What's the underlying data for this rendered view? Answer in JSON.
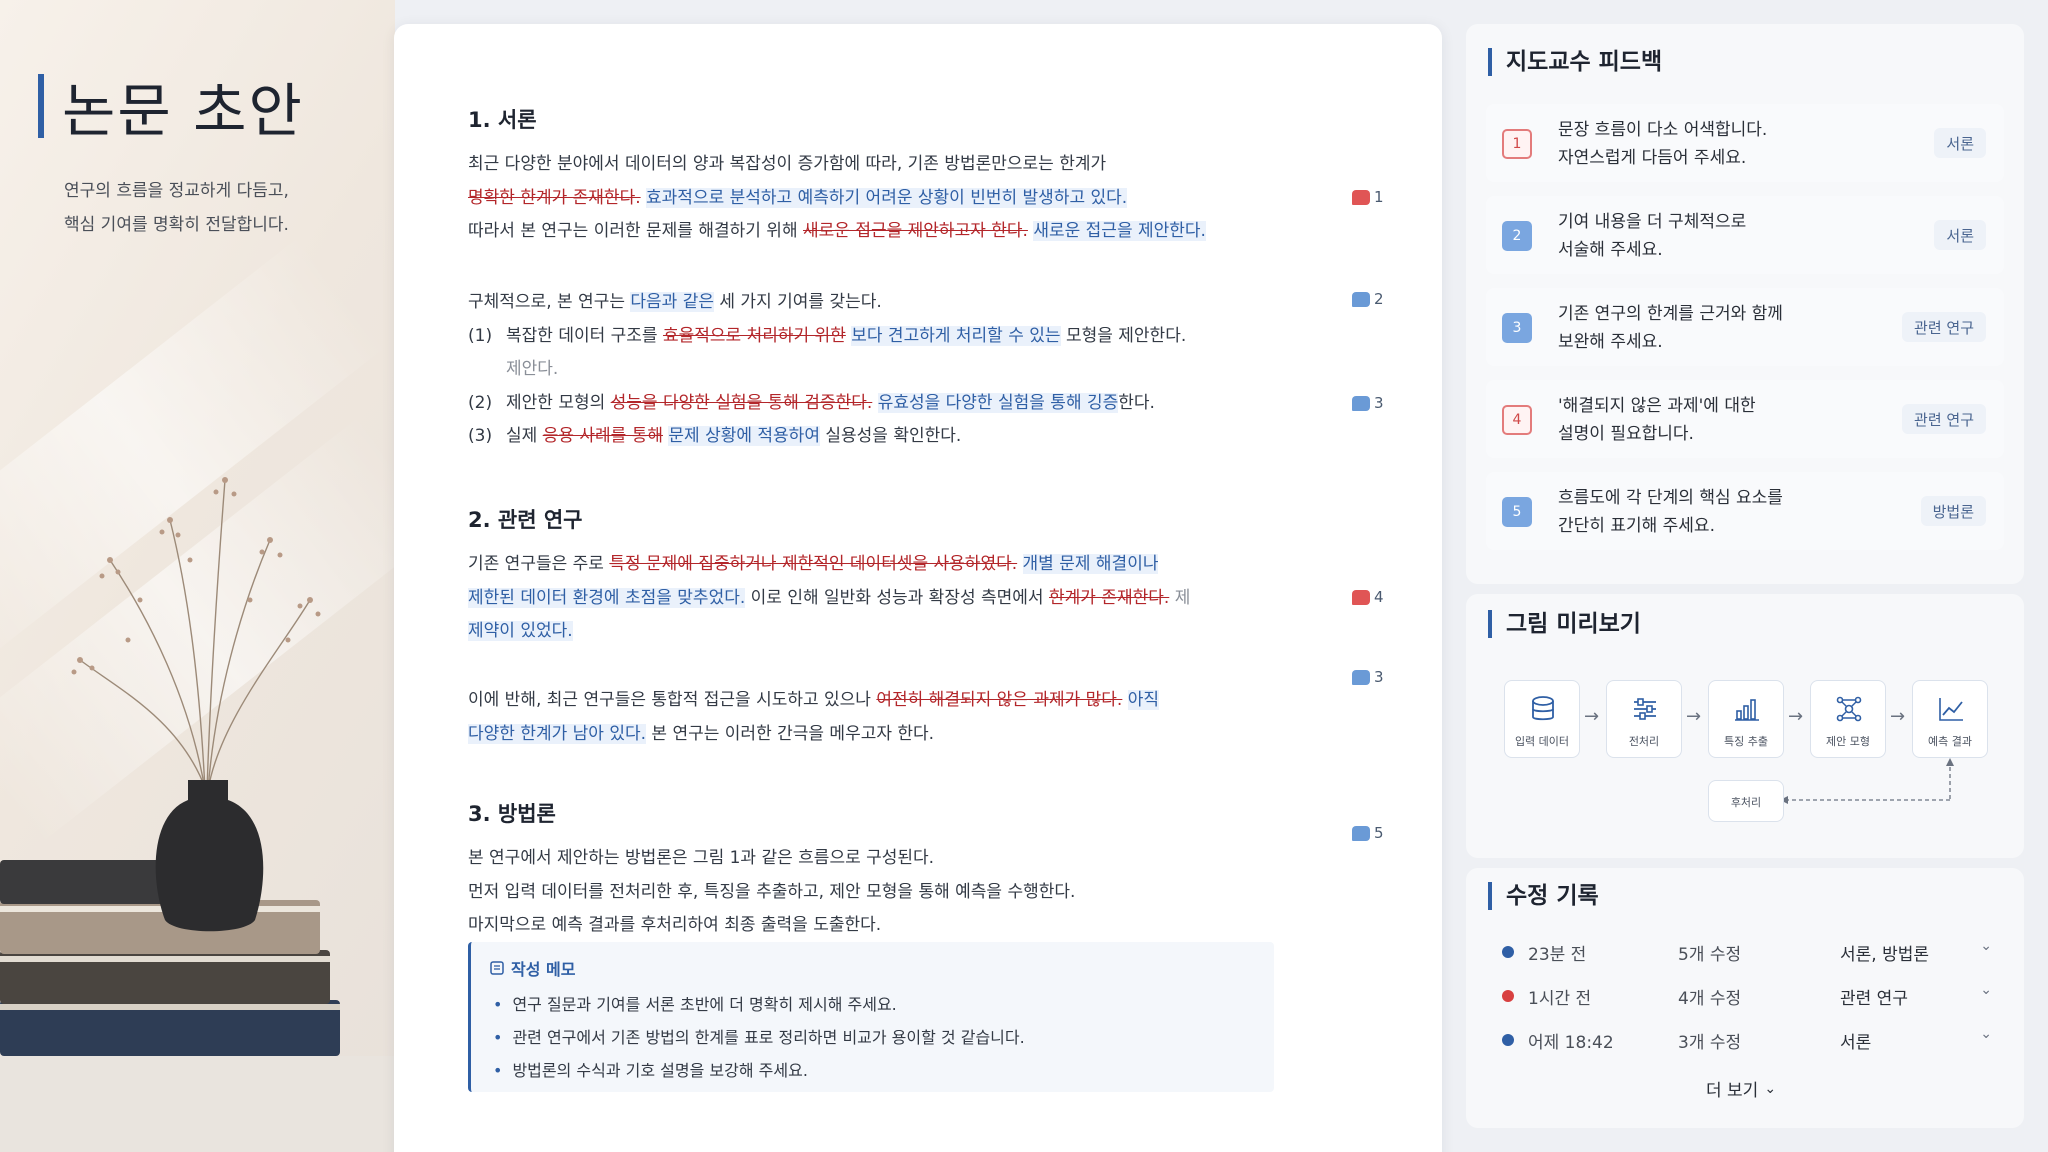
{
  "page": {
    "title": "논문 초안",
    "subtitle_lines": [
      "연구의 흐름을 정교하게 다듬고,",
      "핵심 기여를 명확히 전달합니다."
    ]
  },
  "document": {
    "sections": [
      {
        "title": "1. 서론"
      },
      {
        "title": "2. 관련 연구"
      },
      {
        "title": "3. 방법론"
      }
    ],
    "intro": {
      "p1_l1": "최근 다양한 분야에서 데이터의 양과 복잡성이 증가함에 따라, 기존 방법론만으로는 한계가",
      "p1_l2_del": "명확한 한계가 존재한다.",
      "p1_l2_ins": "효과적으로 분석하고 예측하기 어려운 상황이 빈번히 발생하고 있다.",
      "p1_l3_a": "따라서 본 연구는 이러한 문제를 해결하기 위해 ",
      "p1_l3_del": "새로운 접근을 제안하고자 한다.",
      "p1_l3_ins": "새로운 접근을 제안한다.",
      "p2_a": "구체적으로, 본 연구는 ",
      "p2_ins": "다음과 같은",
      "p2_b": " 세 가지 기여를 갖는다.",
      "item1_num": "(1)",
      "item1_a": "복잡한 데이터 구조를 ",
      "item1_del": "효율적으로 처리하기 위한",
      "item1_ins": "보다 견고하게 처리할 수 있는",
      "item1_b": " 모형을 제안한다.",
      "item1_c": "제안다.",
      "item2_num": "(2)",
      "item2_a": "제안한 모형의 ",
      "item2_del": "성능을 다양한 실험을 통해 검증한다.",
      "item2_ins": "유효성을 다양한 실험을 통해 깅증",
      "item2_b": "한다.",
      "item3_num": "(3)",
      "item3_a": "실제 ",
      "item3_del": "응용 사례를 통해",
      "item3_ins": "문제 상황에 적용하여",
      "item3_b": " 실용성을 확인한다."
    },
    "related": {
      "p1_l1_a": "기존 연구들은 주로 ",
      "p1_l1_del": "특정 문제에 집중하거나 제한적인 데이터셋을 사용하였다.",
      "p1_l1_ins": "개별 문제 해결이나",
      "p1_l2_ins": "제한된 데이터 환경에 초점을 맞추었다.",
      "p1_l2_a": " 이로 인해 일반화 성능과 확장성 측면에서 ",
      "p1_l2_del": "한계가 존재한다.",
      "p1_l2_muted": "제",
      "p1_l3_ins": "제약이 있었다.",
      "p2_l1_a": "이에 반해, 최근 연구들은 통합적 접근을 시도하고 있으나 ",
      "p2_l1_del": "여전히 해결되지 않은 과제가 많다.",
      "p2_l1_ins": "아직",
      "p2_l2_ins": "다양한 한계가 남아 있다.",
      "p2_l2_a": " 본 연구는 이러한 간극을 메우고자 한다."
    },
    "method": {
      "l1": "본 연구에서 제안하는 방법론은 그림 1과 같은 흐름으로 구성된다.",
      "l2": "먼저 입력 데이터를 전처리한 후, 특징을 추출하고, 제안 모형을 통해 예측을 수행한다.",
      "l3": "마지막으로 예측 결과를 후처리하여 최종 출력을 도출한다."
    },
    "comment_marks": [
      {
        "count": "1",
        "color": "red"
      },
      {
        "count": "2",
        "color": "blue"
      },
      {
        "count": "3",
        "color": "blue"
      },
      {
        "count": "4",
        "color": "red"
      },
      {
        "count": "3",
        "color": "blue"
      },
      {
        "count": "5",
        "color": "blue"
      }
    ],
    "memo": {
      "title": "작성 메모",
      "items": [
        "연구 질문과 기여를 서론 초반에 더 명확히 제시해 주세요.",
        "관련 연구에서 기존 방법의 한계를 표로 정리하면 비교가 용이할 것 같습니다.",
        "방법론의 수식과 기호 설명을 보강해 주세요."
      ]
    }
  },
  "feedback": {
    "title": "지도교수 피드백",
    "items": [
      {
        "num": "1",
        "style": "red",
        "line1": "문장 흐름이 다소 어색합니다.",
        "line2": "자연스럽게 다듬어 주세요.",
        "tag": "서론"
      },
      {
        "num": "2",
        "style": "blue",
        "line1": "기여 내용을 더 구체적으로",
        "line2": "서술해 주세요.",
        "tag": "서론"
      },
      {
        "num": "3",
        "style": "blue",
        "line1": "기존 연구의 한계를 근거와 함께",
        "line2": "보완해 주세요.",
        "tag": "관련 연구"
      },
      {
        "num": "4",
        "style": "red",
        "line1": "'해결되지 않은 과제'에 대한",
        "line2": "설명이 필요합니다.",
        "tag": "관련 연구"
      },
      {
        "num": "5",
        "style": "blue",
        "line1": "흐름도에 각 단계의 핵심 요소를",
        "line2": "간단히 표기해 주세요.",
        "tag": "방법론"
      }
    ]
  },
  "figure": {
    "title": "그림 미리보기",
    "steps": [
      {
        "label": "입력 데이터",
        "icon": "database-icon"
      },
      {
        "label": "전처리",
        "icon": "sliders-icon"
      },
      {
        "label": "특징 추출",
        "icon": "bar-chart-icon"
      },
      {
        "label": "제안 모형",
        "icon": "network-icon"
      },
      {
        "label": "예측 결과",
        "icon": "line-chart-icon"
      }
    ],
    "post": "후처리"
  },
  "history": {
    "title": "수정 기록",
    "rows": [
      {
        "time": "23분 전",
        "count": "5개 수정",
        "sections": "서론, 방법론",
        "color": "#2f5fa5"
      },
      {
        "time": "1시간 전",
        "count": "4개 수정",
        "sections": "관련 연구",
        "color": "#d84040"
      },
      {
        "time": "어제 18:42",
        "count": "3개 수정",
        "sections": "서론",
        "color": "#2f5fa5"
      }
    ],
    "more": "더 보기"
  },
  "colors": {
    "accent": "#2f5fa5",
    "deleted": "#b3262a",
    "inserted": "#2f5fa5"
  }
}
